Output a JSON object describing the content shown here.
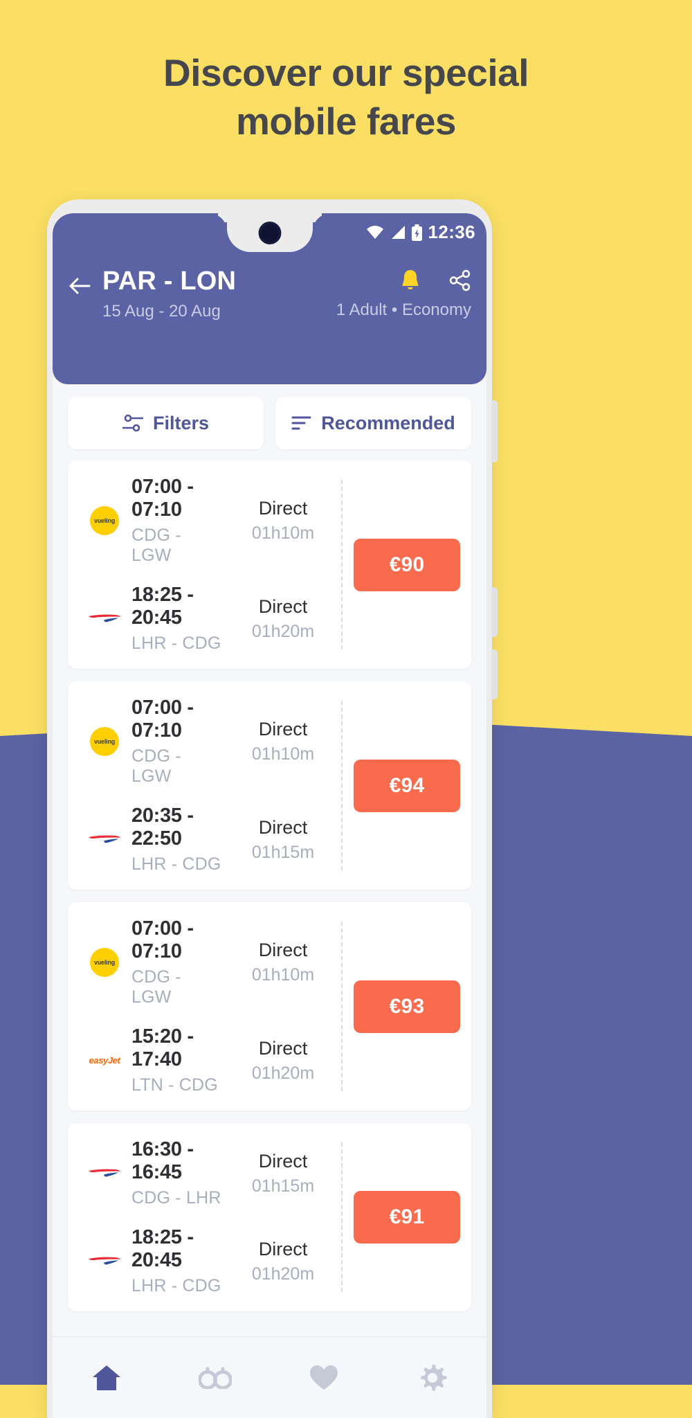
{
  "promo": {
    "headline_line1": "Discover our special",
    "headline_line2": "mobile fares",
    "background_color": "#fadf64",
    "accent_color": "#5b63a4"
  },
  "status_bar": {
    "clock": "12:36",
    "wifi_icon": "wifi-icon",
    "signal_icon": "cellular-signal-icon",
    "battery_icon": "battery-charging-icon"
  },
  "header": {
    "back_icon": "back-arrow-icon",
    "route_title": "PAR - LON",
    "dates": "15 Aug - 20 Aug",
    "passengers": "1 Adult • Economy",
    "bell_icon": "bell-icon",
    "share_icon": "share-icon",
    "background_color": "#5b63a4"
  },
  "toolbar": {
    "filters_label": "Filters",
    "filters_icon": "filters-sliders-icon",
    "sort_label": "Recommended",
    "sort_icon": "sort-lines-icon"
  },
  "flights": [
    {
      "price": "€90",
      "legs": [
        {
          "airline": "vueling",
          "airline_label": "vueling",
          "time": "07:00 - 07:10",
          "route": "CDG - LGW",
          "stops": "Direct",
          "duration": "01h10m"
        },
        {
          "airline": "british-airways",
          "airline_label": "",
          "time": "18:25 - 20:45",
          "route": "LHR - CDG",
          "stops": "Direct",
          "duration": "01h20m"
        }
      ]
    },
    {
      "price": "€94",
      "legs": [
        {
          "airline": "vueling",
          "airline_label": "vueling",
          "time": "07:00 - 07:10",
          "route": "CDG - LGW",
          "stops": "Direct",
          "duration": "01h10m"
        },
        {
          "airline": "british-airways",
          "airline_label": "",
          "time": "20:35 - 22:50",
          "route": "LHR - CDG",
          "stops": "Direct",
          "duration": "01h15m"
        }
      ]
    },
    {
      "price": "€93",
      "legs": [
        {
          "airline": "vueling",
          "airline_label": "vueling",
          "time": "07:00 - 07:10",
          "route": "CDG - LGW",
          "stops": "Direct",
          "duration": "01h10m"
        },
        {
          "airline": "easyjet",
          "airline_label": "easyJet",
          "time": "15:20 - 17:40",
          "route": "LTN - CDG",
          "stops": "Direct",
          "duration": "01h20m"
        }
      ]
    },
    {
      "price": "€91",
      "legs": [
        {
          "airline": "british-airways",
          "airline_label": "",
          "time": "16:30 - 16:45",
          "route": "CDG - LHR",
          "stops": "Direct",
          "duration": "01h15m"
        },
        {
          "airline": "british-airways",
          "airline_label": "",
          "time": "18:25 - 20:45",
          "route": "LHR - CDG",
          "stops": "Direct",
          "duration": "01h20m"
        }
      ]
    }
  ],
  "bottom_nav": [
    {
      "name": "home",
      "icon": "home-icon",
      "active": true
    },
    {
      "name": "explore",
      "icon": "binoculars-icon",
      "active": false
    },
    {
      "name": "favorites",
      "icon": "heart-icon",
      "active": false
    },
    {
      "name": "settings",
      "icon": "gear-icon",
      "active": false
    }
  ],
  "colors": {
    "price_badge": "#fa6a4d",
    "vueling_yellow": "#ffcf00",
    "easyjet_orange": "#ff6600"
  }
}
